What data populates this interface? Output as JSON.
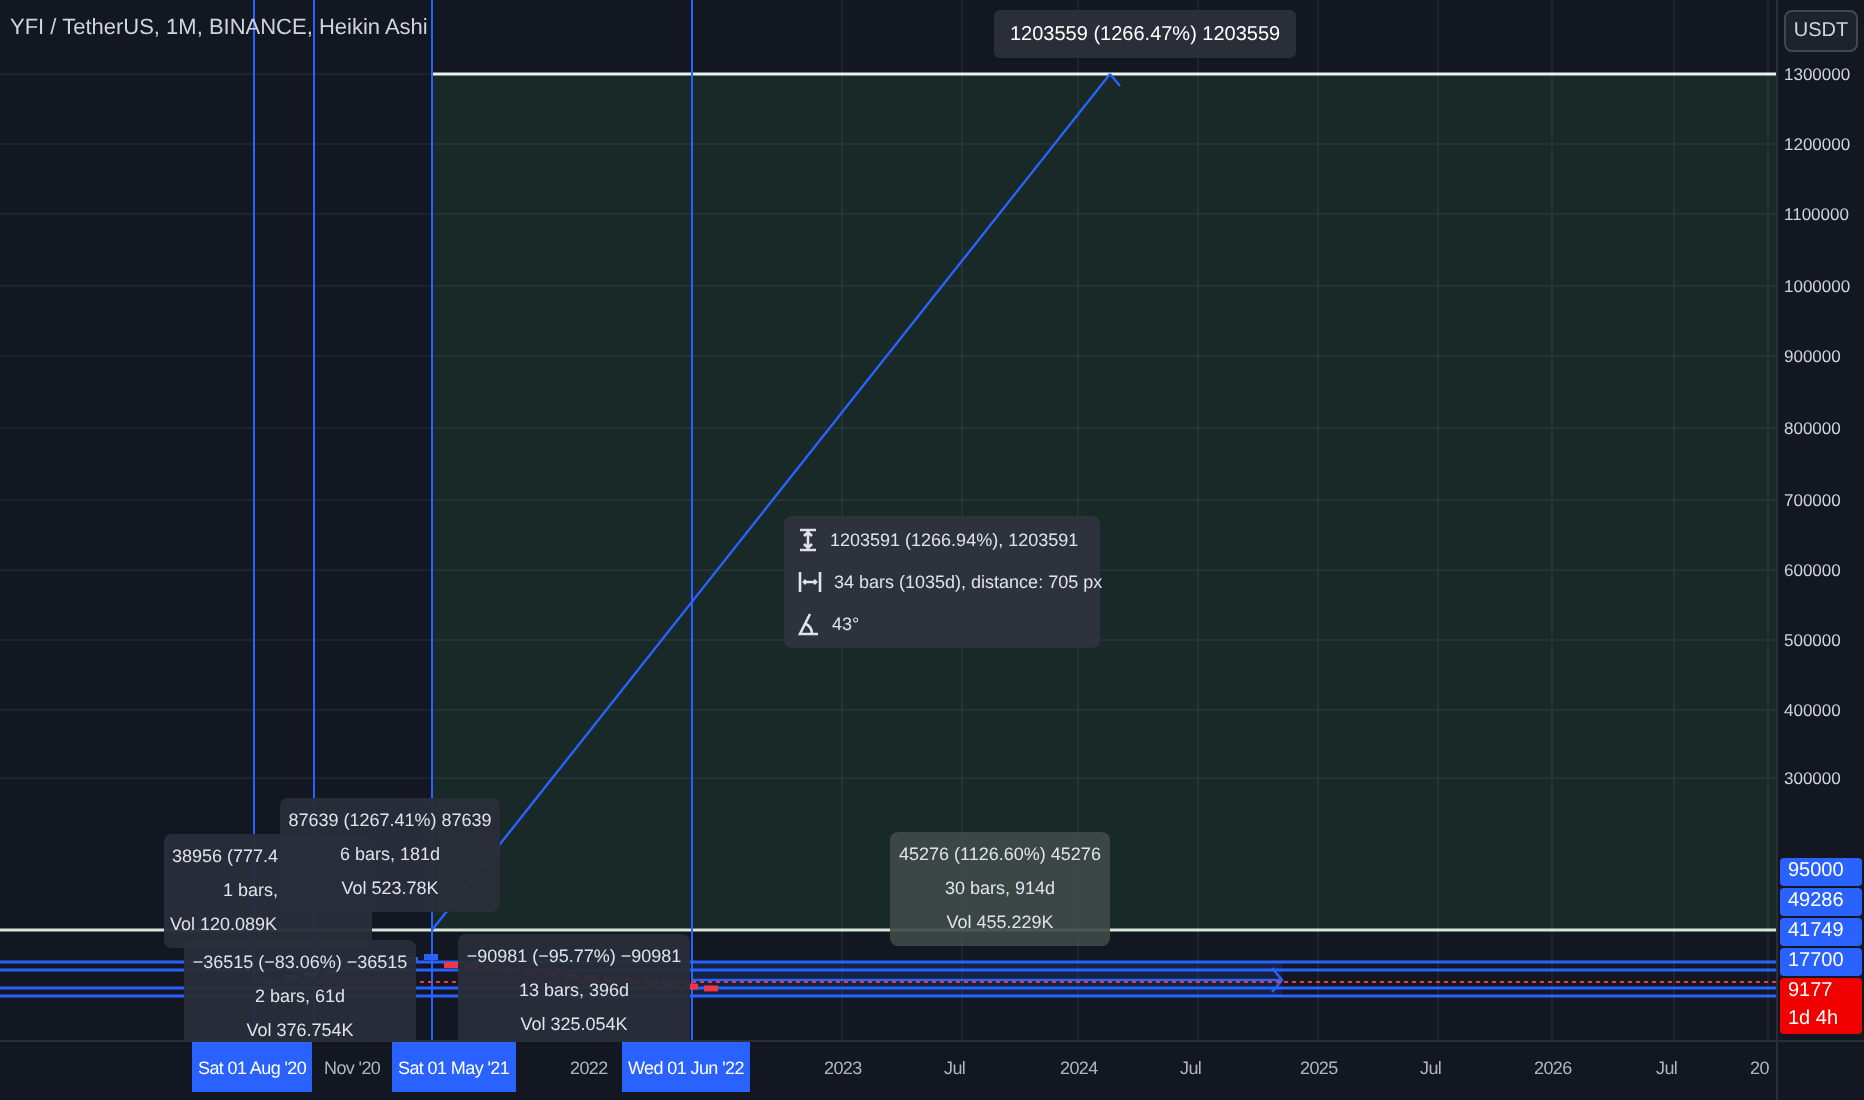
{
  "chart": {
    "title": "YFI / TetherUS, 1M, BINANCE, Heikin Ashi",
    "currency": "USDT"
  },
  "projection_label": "1203559 (1266.47%) 1203559",
  "measure_labels": [
    {
      "lines": [
        "38956 (777.4",
        "1 bars,",
        "Vol 120.089K"
      ]
    },
    {
      "lines": [
        "−36515 (−83.06%) −36515",
        "2 bars, 61d",
        "Vol 376.754K"
      ]
    },
    {
      "lines": [
        "87639 (1267.41%) 87639",
        "6 bars, 181d",
        "Vol 523.78K"
      ]
    },
    {
      "lines": [
        "−90981 (−95.77%) −90981",
        "13 bars, 396d",
        "Vol 325.054K"
      ]
    },
    {
      "lines": [
        "45276 (1126.60%) 45276",
        "30 bars, 914d",
        "Vol 455.229K"
      ]
    }
  ],
  "info_tooltip": {
    "rows": [
      {
        "kind": "price",
        "text": "1203591 (1266.94%), 1203591"
      },
      {
        "kind": "range",
        "text": "34 bars (1035d), distance: 705 px"
      },
      {
        "kind": "angle",
        "text": "43°"
      }
    ]
  },
  "price_axis": {
    "ticks": [
      "1300000",
      "1200000",
      "1100000",
      "1000000",
      "900000",
      "800000",
      "700000",
      "600000",
      "500000",
      "400000",
      "300000"
    ],
    "badges": [
      {
        "text": "95000",
        "color": "#2962ff"
      },
      {
        "text": "49286",
        "color": "#2962ff"
      },
      {
        "text": "41749",
        "color": "#2962ff"
      },
      {
        "text": "17700",
        "color": "#2962ff"
      },
      {
        "text": "9177",
        "subtext": "1d 4h",
        "color": "#f20000"
      }
    ]
  },
  "time_axis": {
    "labels": [
      {
        "text": "Sat 01 Aug '20",
        "highlighted": true
      },
      {
        "text": "Nov '20",
        "highlighted": false
      },
      {
        "text": "Sat 01 May '21",
        "highlighted": true
      },
      {
        "text": "2022",
        "highlighted": false
      },
      {
        "text": "Wed 01 Jun '22",
        "highlighted": true
      },
      {
        "text": "2023",
        "highlighted": false
      },
      {
        "text": "Jul",
        "highlighted": false
      },
      {
        "text": "2024",
        "highlighted": false
      },
      {
        "text": "Jul",
        "highlighted": false
      },
      {
        "text": "2025",
        "highlighted": false
      },
      {
        "text": "Jul",
        "highlighted": false
      },
      {
        "text": "2026",
        "highlighted": false
      },
      {
        "text": "Jul",
        "highlighted": false
      },
      {
        "text": "20",
        "highlighted": false
      }
    ]
  }
}
